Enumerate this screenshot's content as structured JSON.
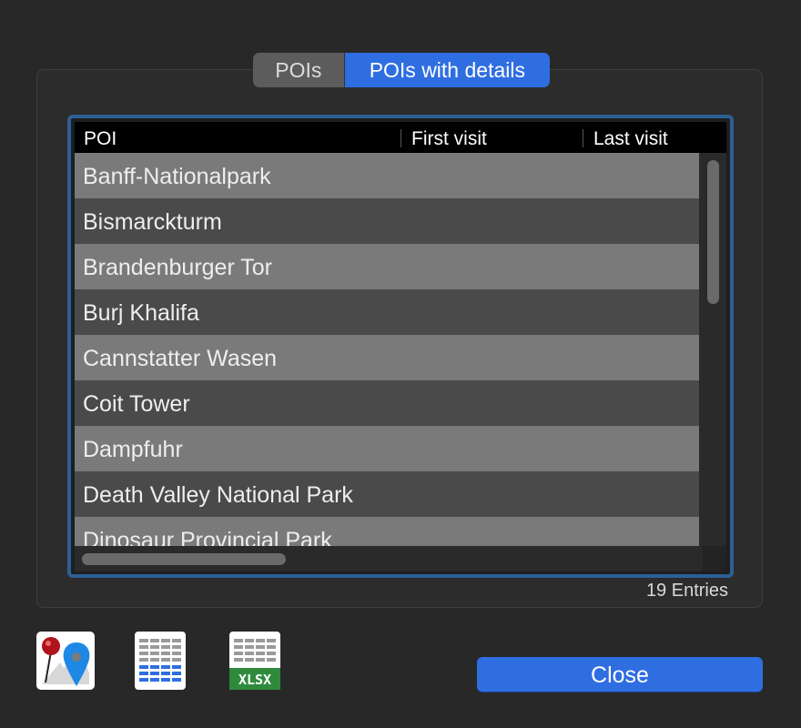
{
  "tabs": [
    {
      "label": "POIs",
      "selected": false
    },
    {
      "label": "POIs with details",
      "selected": true
    }
  ],
  "table": {
    "columns": [
      "POI",
      "First visit",
      "Last visit"
    ],
    "rows": [
      {
        "poi": "Banff-Nationalpark",
        "first_visit": "",
        "last_visit": ""
      },
      {
        "poi": "Bismarckturm",
        "first_visit": "",
        "last_visit": ""
      },
      {
        "poi": "Brandenburger Tor",
        "first_visit": "",
        "last_visit": ""
      },
      {
        "poi": "Burj Khalifa",
        "first_visit": "",
        "last_visit": ""
      },
      {
        "poi": "Cannstatter Wasen",
        "first_visit": "",
        "last_visit": ""
      },
      {
        "poi": "Coit Tower",
        "first_visit": "",
        "last_visit": ""
      },
      {
        "poi": "Dampfuhr",
        "first_visit": "",
        "last_visit": ""
      },
      {
        "poi": "Death Valley National Park",
        "first_visit": "",
        "last_visit": ""
      },
      {
        "poi": "Dinosaur Provincial Park",
        "first_visit": "",
        "last_visit": ""
      }
    ]
  },
  "entries_label": "19 Entries",
  "export": {
    "xlsx_label": "XLSX"
  },
  "close_label": "Close",
  "icons": {
    "map_pins": "map-pins-icon",
    "table": "table-export-icon",
    "xlsx": "xlsx-export-icon"
  },
  "colors": {
    "accent": "#2f6ee0",
    "table_border": "#2d5f94",
    "row_light": "#7a7a7a",
    "row_dark": "#4a4a4a",
    "background": "#282828"
  }
}
